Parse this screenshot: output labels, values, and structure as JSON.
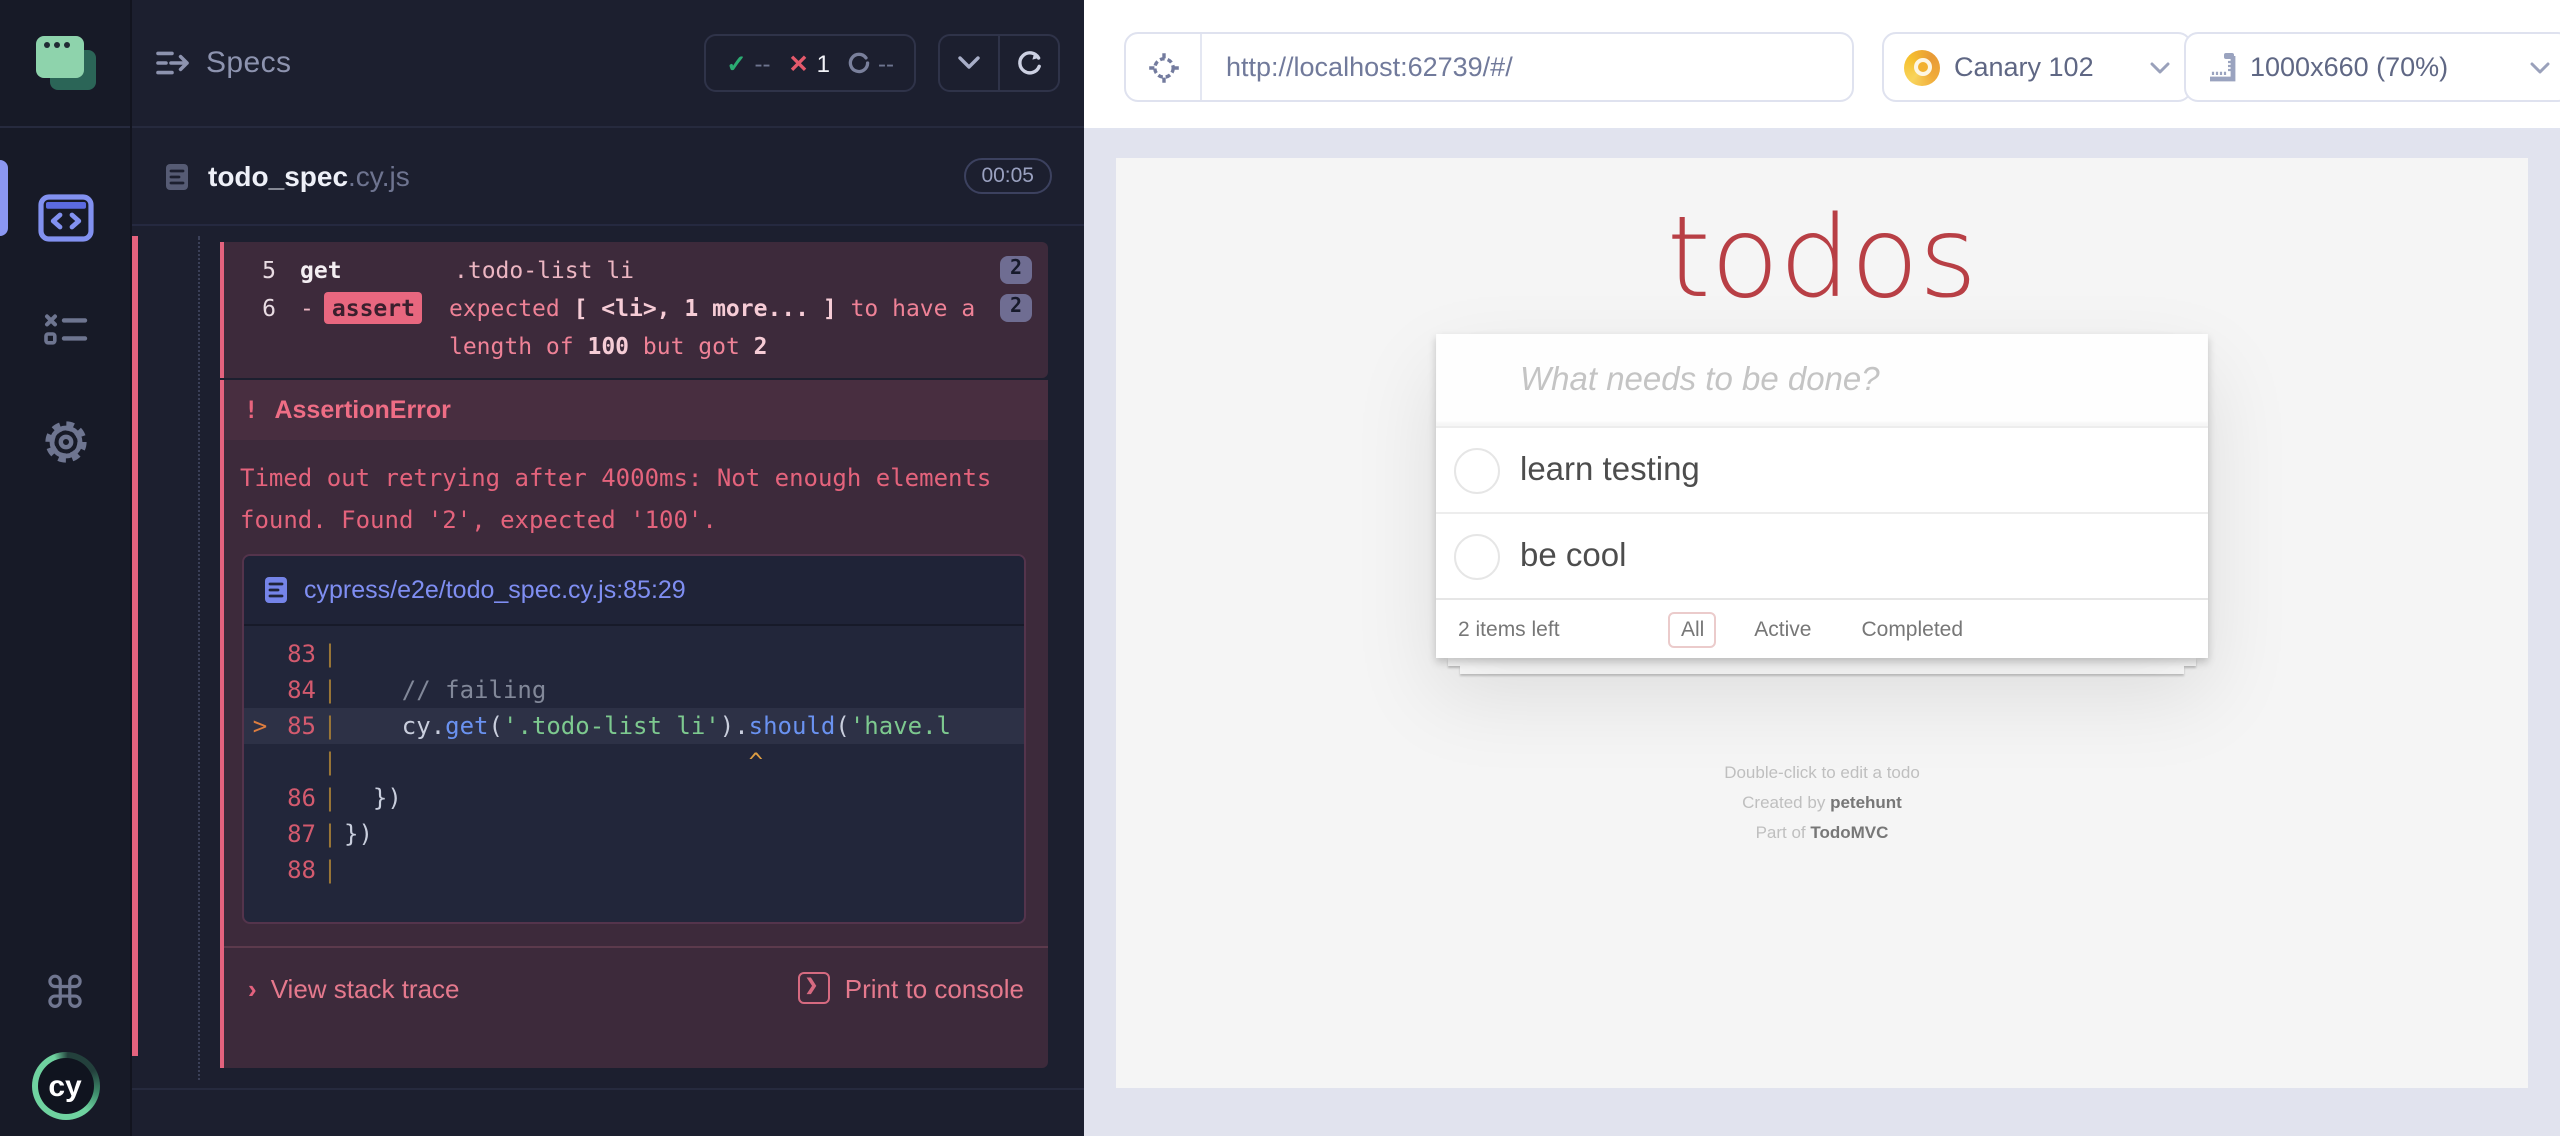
{
  "rail": {
    "logo_text": "cy",
    "command_glyph": "⌘"
  },
  "reporter": {
    "title": "Specs",
    "stats": {
      "passed": "--",
      "failed": "1",
      "pending": "--"
    },
    "spec": {
      "name": "todo_spec",
      "ext": ".cy.js",
      "timer": "00:05"
    },
    "commands": {
      "line5": {
        "num": "5",
        "method": "get",
        "message": ".todo-list li",
        "count": "2"
      },
      "line6": {
        "num": "6",
        "dash": "-",
        "badge": "assert",
        "m1": "expected ",
        "m2": "[ <li>, 1 more... ]",
        "m3": " to have a length of ",
        "m4": "100",
        "m5": " but got ",
        "m6": "2",
        "count": "2"
      }
    },
    "error": {
      "bang": "!",
      "name": "AssertionError",
      "message": "Timed out retrying after 4000ms: Not enough elements found. Found '2', expected '100'.",
      "file_link": "cypress/e2e/todo_spec.cy.js:85:29",
      "code": {
        "l83": {
          "num": "83",
          "pipe": "|"
        },
        "l84": {
          "num": "84",
          "pipe": "|",
          "comment": "    // failing"
        },
        "l85": {
          "arrow": ">",
          "num": "85",
          "pipe": "|",
          "a": "    cy.",
          "fn1": "get",
          "p1": "(",
          "s1": "'.todo-list li'",
          "p2": ").",
          "fn2": "should",
          "p3": "(",
          "s2": "'have.l"
        },
        "lcaret": {
          "pipe": "|",
          "caret": "                            ^"
        },
        "l86": {
          "num": "86",
          "pipe": "|",
          "text": "  })"
        },
        "l87": {
          "num": "87",
          "pipe": "|",
          "text": "})"
        },
        "l88": {
          "num": "88",
          "pipe": "|"
        }
      },
      "stack_chevron": "›",
      "stack_label": "View stack trace",
      "print_chevron": "❯",
      "print_label": "Print to console"
    }
  },
  "browser_bar": {
    "url": "http://localhost:62739/#/",
    "browser": "Canary 102",
    "viewport": "1000x660 (70%)"
  },
  "app": {
    "title": "todos",
    "input_placeholder": "What needs to be done?",
    "todos": [
      "learn testing",
      "be cool"
    ],
    "items_left": "2 items left",
    "filters": {
      "all": "All",
      "active": "Active",
      "completed": "Completed"
    },
    "info_edit": "Double-click to edit a todo",
    "info_created_prefix": "Created by ",
    "info_created_name": "petehunt",
    "info_part_prefix": "Part of ",
    "info_part_name": "TodoMVC"
  }
}
